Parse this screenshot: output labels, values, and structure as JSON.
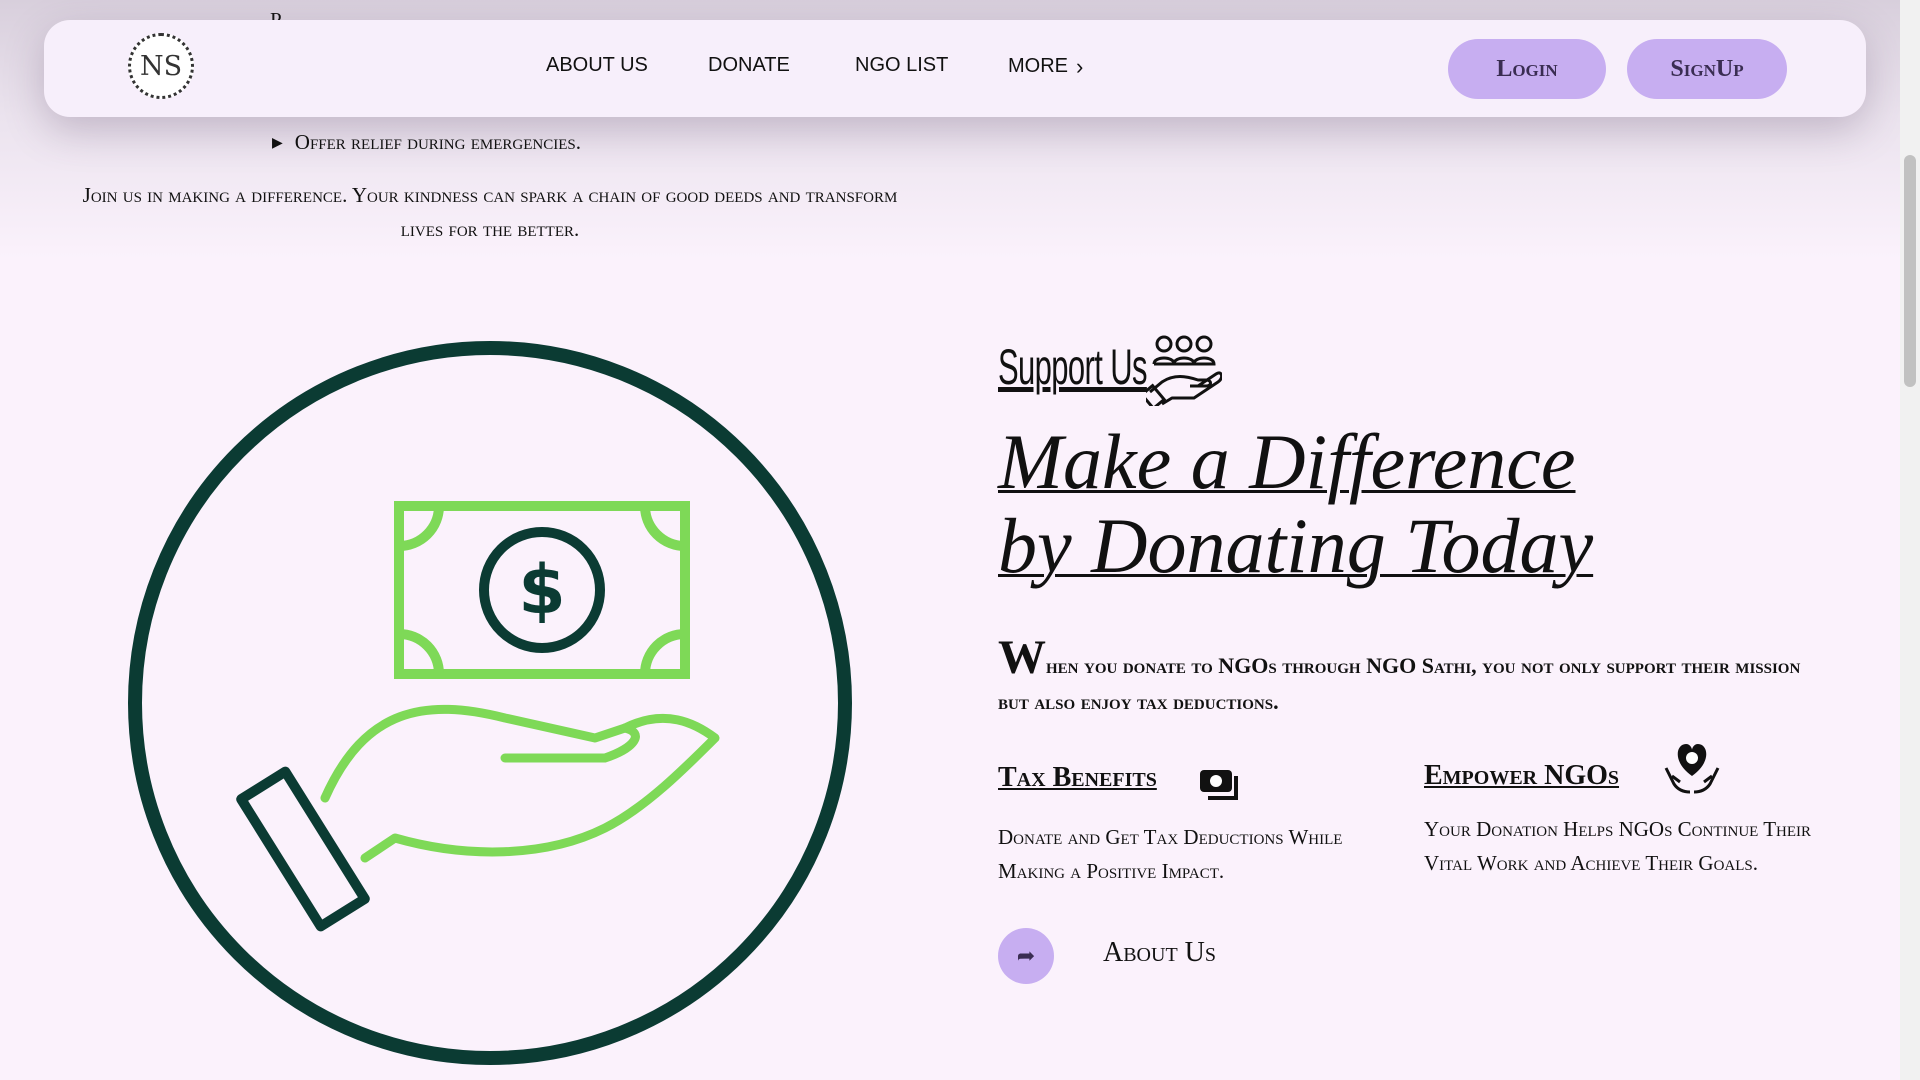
{
  "nav": {
    "logo_text": "NS",
    "links": [
      "ABOUT US",
      "DONATE",
      "NGO LIST",
      "MORE"
    ],
    "login_label": "Login",
    "signup_label": "SignUp"
  },
  "intro_section": {
    "cut_bullet": "P",
    "bullet": "Offer relief during emergencies.",
    "join_text": "Join us in making a difference. Your kindness can spark a chain of good deeds and transform lives for the better."
  },
  "support": {
    "label": "Support Us",
    "headline": "Make a Difference by Donating Today",
    "intro_initial": "W",
    "intro_rest": "hen you donate to NGOs through NGO Sathi, you not only support their mission but also enjoy tax deductions.",
    "features": [
      {
        "title": "Tax Benefits",
        "desc": "Donate and Get Tax Deductions While Making a Positive Impact.",
        "icon": "money-icon"
      },
      {
        "title": "Empower NGOs",
        "desc": "Your Donation Helps NGOs Continue Their Vital Work and Achieve Their Goals.",
        "icon": "heart-hands-icon"
      }
    ],
    "about_label": "About Us"
  },
  "colors": {
    "background": "#fbf2fc",
    "button": "#c7aef1",
    "illustration_dark": "#0b3b33",
    "illustration_green": "#7ed957"
  }
}
